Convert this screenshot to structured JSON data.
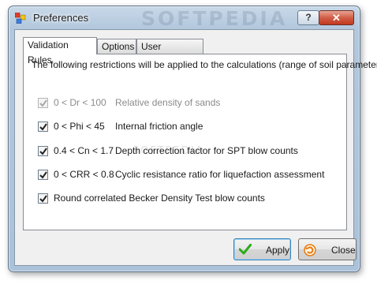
{
  "window": {
    "title": "Preferences",
    "watermark": "SOFTPEDIA",
    "help_label": "?",
    "close_label": "✕"
  },
  "tabs": [
    {
      "label": "Validation Rules",
      "active": true
    },
    {
      "label": "Options",
      "active": false
    },
    {
      "label": "User Interface",
      "active": false
    }
  ],
  "validation": {
    "intro": "The following restrictions will be applied to the calculations (range of soil parameters):",
    "rules": [
      {
        "condition": "0 < Dr < 100",
        "description": "Relative density of sands",
        "checked": true,
        "enabled": false
      },
      {
        "condition": "0 < Phi < 45",
        "description": "Internal friction angle",
        "checked": true,
        "enabled": true
      },
      {
        "condition": "0.4 < Cn < 1.7",
        "description": "Depth correction factor for SPT blow counts",
        "checked": true,
        "enabled": true
      },
      {
        "condition": "0 < CRR < 0.8",
        "description": "Cyclic resistance ratio for liquefaction assessment",
        "checked": true,
        "enabled": true
      }
    ],
    "becker": {
      "label": "Round correlated Becker Density Test blow counts",
      "checked": true
    }
  },
  "buttons": {
    "apply": "Apply",
    "close": "Close"
  },
  "colors": {
    "apply_icon": "#2eaa1e",
    "close_icon": "#e67a12"
  }
}
